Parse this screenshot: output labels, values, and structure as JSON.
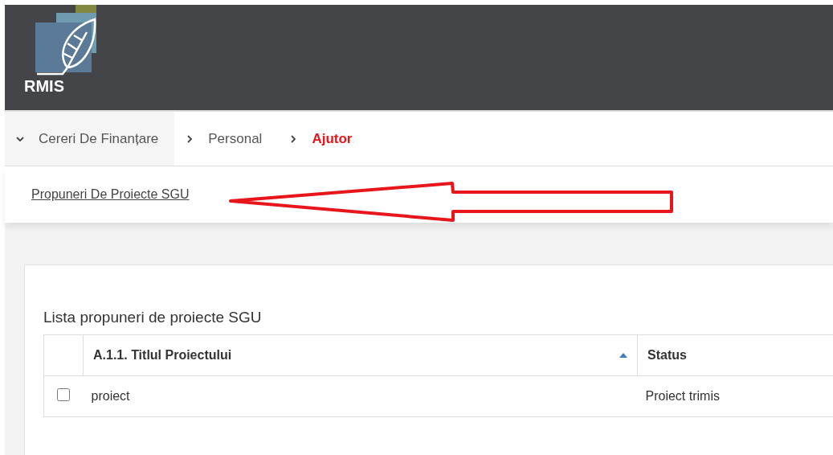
{
  "logo": {
    "text": "RMIS"
  },
  "menu": [
    {
      "label": "Cereri De Finanțare",
      "expanded": true,
      "selected": false
    },
    {
      "label": "Personal",
      "expanded": false,
      "selected": false
    },
    {
      "label": "Ajutor",
      "expanded": false,
      "selected": true
    }
  ],
  "submenu_link": "Propuneri De Proiecte SGU",
  "panel": {
    "title": "Lista propuneri de proiecte SGU",
    "table": {
      "columns": [
        {
          "label": "A.1.1. Titlul Proiectului",
          "sorted": true
        },
        {
          "label": "Status",
          "sorted": false
        }
      ],
      "rows": [
        {
          "checked": false,
          "cells": [
            "proiect",
            "Proiect trimis"
          ]
        }
      ]
    }
  }
}
